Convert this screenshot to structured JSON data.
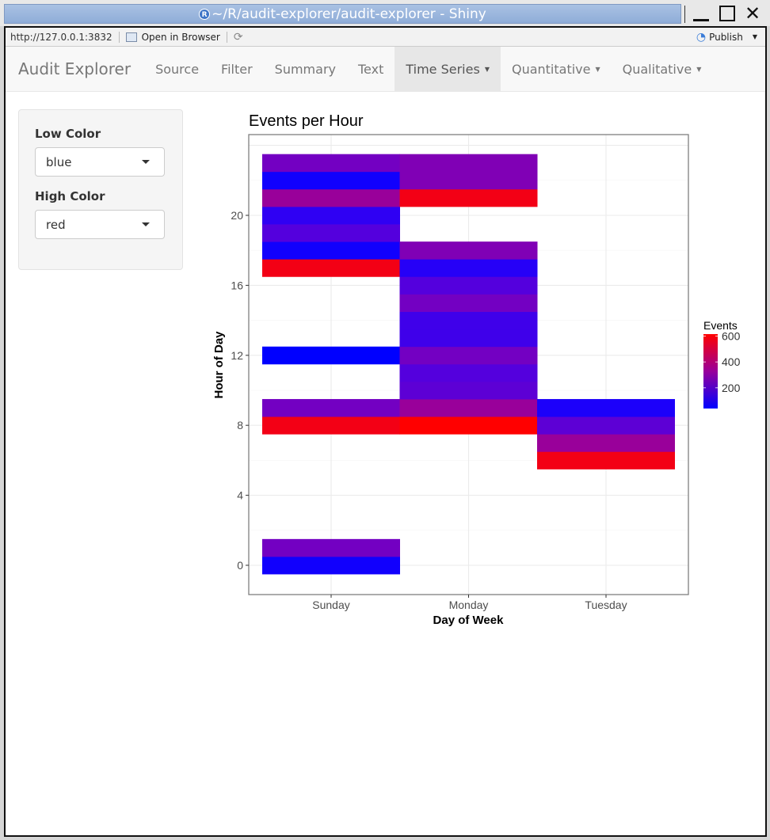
{
  "window": {
    "title": "~/R/audit-explorer/audit-explorer - Shiny",
    "r_logo": "R",
    "close_glyph": "✕"
  },
  "urlbar": {
    "url": "http://127.0.0.1:3832",
    "open_in_browser": "Open in Browser",
    "refresh_glyph": "⟳",
    "publish": "Publish",
    "publish_icon_glyph": "◔",
    "caret": "▼"
  },
  "navbar": {
    "brand": "Audit Explorer",
    "items": [
      {
        "label": "Source"
      },
      {
        "label": "Filter"
      },
      {
        "label": "Summary"
      },
      {
        "label": "Text"
      },
      {
        "label": "Time Series",
        "dropdown": "▼"
      },
      {
        "label": "Quantitative",
        "dropdown": "▼"
      },
      {
        "label": "Qualitative",
        "dropdown": "▼"
      }
    ]
  },
  "sidebar": {
    "low_color_label": "Low Color",
    "low_color_value": "blue",
    "high_color_label": "High Color",
    "high_color_value": "red"
  },
  "chart_data": {
    "type": "heatmap",
    "title": "Events per Hour",
    "xlabel": "Day of Week",
    "ylabel": "Hour of Day",
    "categories": [
      "Sunday",
      "Monday",
      "Tuesday"
    ],
    "yticks": [
      0,
      4,
      8,
      12,
      16,
      20
    ],
    "ylim": [
      -1.7,
      24.6
    ],
    "grid": true,
    "legend": {
      "title": "Events",
      "ticks": [
        200,
        400,
        600
      ],
      "range": [
        40,
        615
      ],
      "low_color": "#0000ff",
      "high_color": "#ff0000",
      "placement": "right"
    },
    "cells": [
      {
        "day": "Sunday",
        "hour": 0,
        "events": 55
      },
      {
        "day": "Sunday",
        "hour": 1,
        "events": 240
      },
      {
        "day": "Sunday",
        "hour": 8,
        "events": 580
      },
      {
        "day": "Sunday",
        "hour": 9,
        "events": 240
      },
      {
        "day": "Sunday",
        "hour": 12,
        "events": 40
      },
      {
        "day": "Sunday",
        "hour": 17,
        "events": 580
      },
      {
        "day": "Sunday",
        "hour": 18,
        "events": 55
      },
      {
        "day": "Sunday",
        "hour": 19,
        "events": 170
      },
      {
        "day": "Sunday",
        "hour": 20,
        "events": 100
      },
      {
        "day": "Sunday",
        "hour": 21,
        "events": 330
      },
      {
        "day": "Sunday",
        "hour": 22,
        "events": 55
      },
      {
        "day": "Sunday",
        "hour": 23,
        "events": 240
      },
      {
        "day": "Monday",
        "hour": 8,
        "events": 615
      },
      {
        "day": "Monday",
        "hour": 9,
        "events": 330
      },
      {
        "day": "Monday",
        "hour": 10,
        "events": 190
      },
      {
        "day": "Monday",
        "hour": 11,
        "events": 170
      },
      {
        "day": "Monday",
        "hour": 12,
        "events": 240
      },
      {
        "day": "Monday",
        "hour": 13,
        "events": 130
      },
      {
        "day": "Monday",
        "hour": 14,
        "events": 130
      },
      {
        "day": "Monday",
        "hour": 15,
        "events": 240
      },
      {
        "day": "Monday",
        "hour": 16,
        "events": 170
      },
      {
        "day": "Monday",
        "hour": 17,
        "events": 85
      },
      {
        "day": "Monday",
        "hour": 18,
        "events": 270
      },
      {
        "day": "Monday",
        "hour": 21,
        "events": 580
      },
      {
        "day": "Monday",
        "hour": 22,
        "events": 270
      },
      {
        "day": "Monday",
        "hour": 23,
        "events": 270
      },
      {
        "day": "Tuesday",
        "hour": 6,
        "events": 580
      },
      {
        "day": "Tuesday",
        "hour": 7,
        "events": 330
      },
      {
        "day": "Tuesday",
        "hour": 8,
        "events": 190
      },
      {
        "day": "Tuesday",
        "hour": 9,
        "events": 70
      }
    ]
  }
}
